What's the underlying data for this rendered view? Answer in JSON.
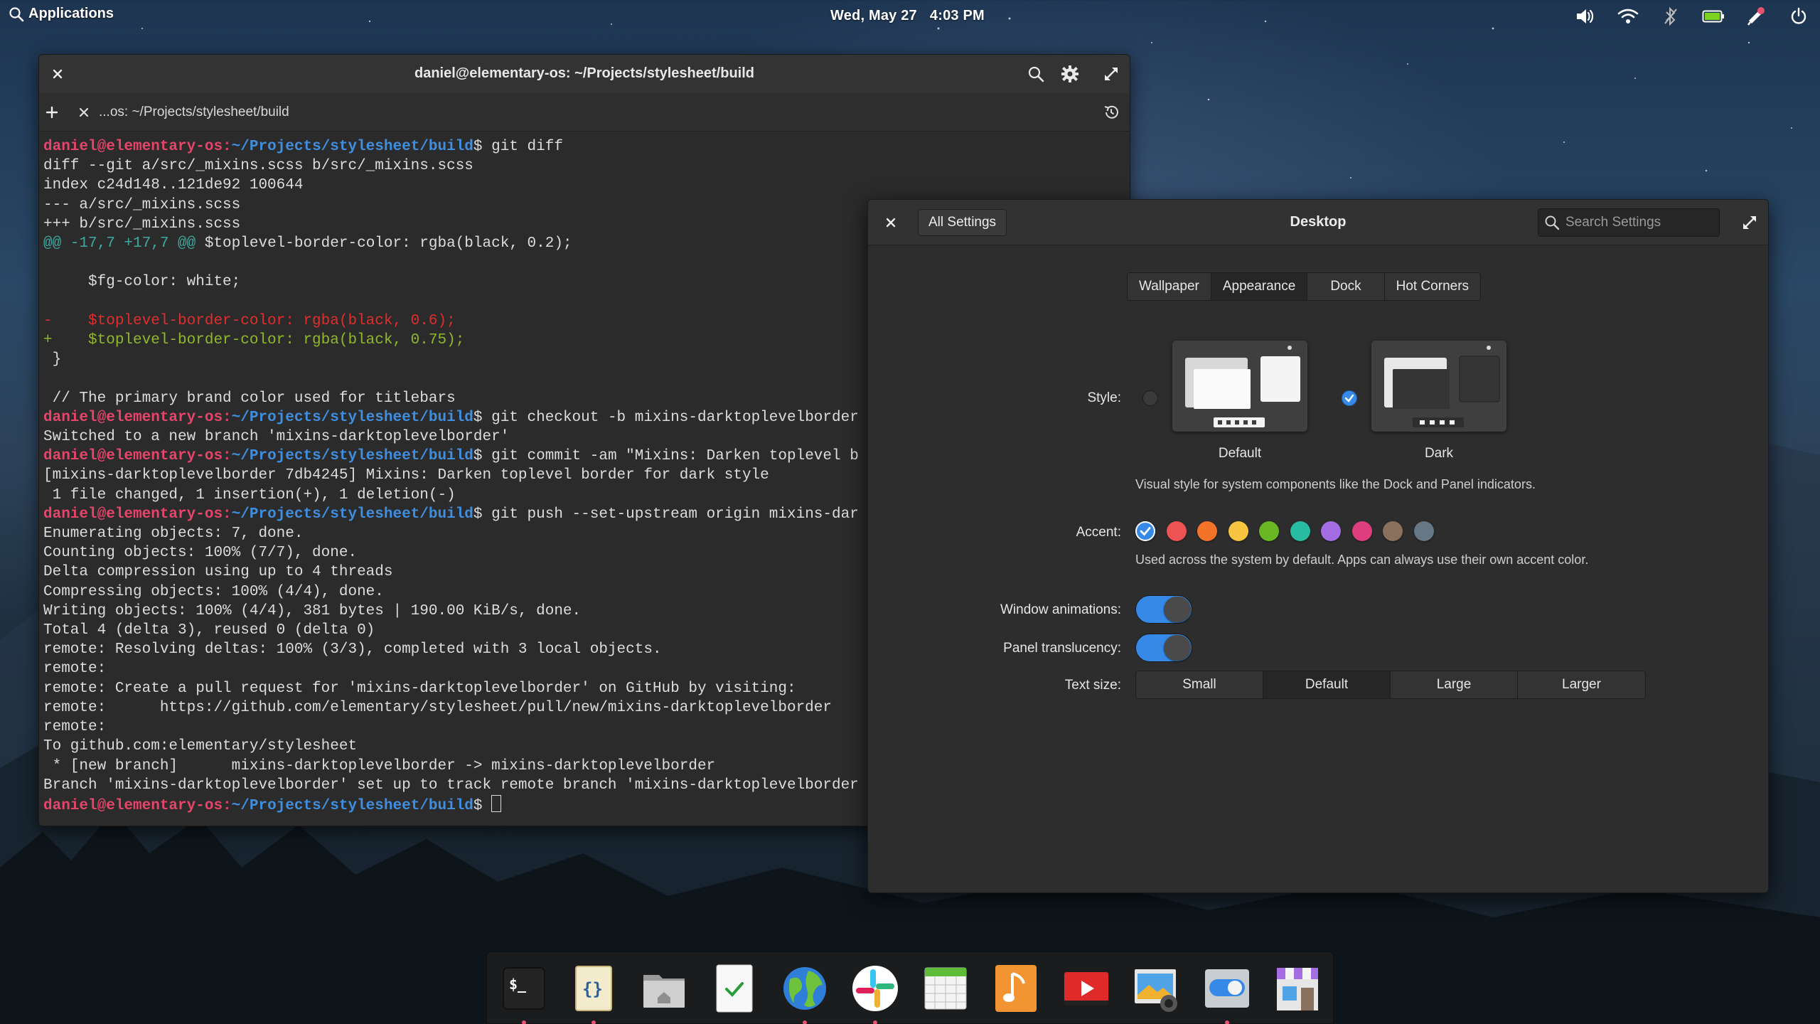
{
  "panel": {
    "applications_label": "Applications",
    "date": "Wed, May 27",
    "time": "4:03 PM",
    "indicators": [
      "volume-icon",
      "wifi-icon",
      "bluetooth-icon",
      "battery-icon",
      "notifications-icon",
      "power-icon"
    ]
  },
  "terminal": {
    "title": "daniel@elementary-os: ~/Projects/stylesheet/build",
    "tab_label": "...os: ~/Projects/stylesheet/build",
    "prompt_user": "daniel@elementary-os:",
    "prompt_path": "~/Projects/stylesheet/build",
    "lines": [
      {
        "type": "prompt",
        "cmd": " git diff"
      },
      {
        "type": "plain",
        "text": "diff --git a/src/_mixins.scss b/src/_mixins.scss"
      },
      {
        "type": "plain",
        "text": "index c24d148..121de92 100644"
      },
      {
        "type": "plain",
        "text": "--- a/src/_mixins.scss"
      },
      {
        "type": "plain",
        "text": "+++ b/src/_mixins.scss"
      },
      {
        "type": "hunk",
        "marker": "@@ -17,7 +17,7 @@",
        "text": " $toplevel-border-color: rgba(black, 0.2);"
      },
      {
        "type": "plain",
        "text": " "
      },
      {
        "type": "plain",
        "text": "     $fg-color: white;"
      },
      {
        "type": "plain",
        "text": " "
      },
      {
        "type": "del",
        "text": "-    $toplevel-border-color: rgba(black, 0.6);"
      },
      {
        "type": "add",
        "text": "+    $toplevel-border-color: rgba(black, 0.75);"
      },
      {
        "type": "plain",
        "text": " }"
      },
      {
        "type": "plain",
        "text": " "
      },
      {
        "type": "plain",
        "text": " // The primary brand color used for titlebars"
      },
      {
        "type": "prompt",
        "cmd": " git checkout -b mixins-darktoplevelborder"
      },
      {
        "type": "plain",
        "text": "Switched to a new branch 'mixins-darktoplevelborder'"
      },
      {
        "type": "prompt",
        "cmd": " git commit -am \"Mixins: Darken toplevel b"
      },
      {
        "type": "plain",
        "text": "[mixins-darktoplevelborder 7db4245] Mixins: Darken toplevel border for dark style"
      },
      {
        "type": "plain",
        "text": " 1 file changed, 1 insertion(+), 1 deletion(-)"
      },
      {
        "type": "prompt",
        "cmd": " git push --set-upstream origin mixins-dar"
      },
      {
        "type": "plain",
        "text": "Enumerating objects: 7, done."
      },
      {
        "type": "plain",
        "text": "Counting objects: 100% (7/7), done."
      },
      {
        "type": "plain",
        "text": "Delta compression using up to 4 threads"
      },
      {
        "type": "plain",
        "text": "Compressing objects: 100% (4/4), done."
      },
      {
        "type": "plain",
        "text": "Writing objects: 100% (4/4), 381 bytes | 190.00 KiB/s, done."
      },
      {
        "type": "plain",
        "text": "Total 4 (delta 3), reused 0 (delta 0)"
      },
      {
        "type": "plain",
        "text": "remote: Resolving deltas: 100% (3/3), completed with 3 local objects."
      },
      {
        "type": "plain",
        "text": "remote:"
      },
      {
        "type": "plain",
        "text": "remote: Create a pull request for 'mixins-darktoplevelborder' on GitHub by visiting:"
      },
      {
        "type": "plain",
        "text": "remote:      https://github.com/elementary/stylesheet/pull/new/mixins-darktoplevelborder"
      },
      {
        "type": "plain",
        "text": "remote:"
      },
      {
        "type": "plain",
        "text": "To github.com:elementary/stylesheet"
      },
      {
        "type": "plain",
        "text": " * [new branch]      mixins-darktoplevelborder -> mixins-darktoplevelborder"
      },
      {
        "type": "plain",
        "text": "Branch 'mixins-darktoplevelborder' set up to track remote branch 'mixins-darktoplevelborder"
      },
      {
        "type": "prompt_cursor",
        "cmd": " "
      }
    ]
  },
  "settings": {
    "all_settings_label": "All Settings",
    "title": "Desktop",
    "search_placeholder": "Search Settings",
    "tabs": [
      "Wallpaper",
      "Appearance",
      "Dock",
      "Hot Corners"
    ],
    "active_tab": "Appearance",
    "style_label": "Style:",
    "style_options": [
      {
        "caption": "Default",
        "selected": false
      },
      {
        "caption": "Dark",
        "selected": true
      }
    ],
    "style_desc": "Visual style for system components like the Dock and Panel indicators.",
    "accent_label": "Accent:",
    "accent_colors": [
      "#3689e6",
      "#ed5353",
      "#f37329",
      "#f9c440",
      "#68b723",
      "#28bca3",
      "#a56de2",
      "#de3e80",
      "#8a715e",
      "#667885"
    ],
    "accent_selected": 0,
    "accent_desc": "Used across the system by default. Apps can always use their own accent color.",
    "window_animations_label": "Window animations:",
    "window_animations_on": true,
    "panel_translucency_label": "Panel translucency:",
    "panel_translucency_on": true,
    "text_size_label": "Text size:",
    "text_sizes": [
      "Small",
      "Default",
      "Large",
      "Larger"
    ],
    "text_size_selected": "Default"
  },
  "dock": {
    "apps": [
      "terminal-icon",
      "code-icon",
      "files-icon",
      "tasks-icon",
      "browser-icon",
      "slack-icon",
      "calendar-icon",
      "music-icon",
      "videos-icon",
      "photos-icon",
      "settings-icon",
      "appcenter-icon"
    ]
  }
}
